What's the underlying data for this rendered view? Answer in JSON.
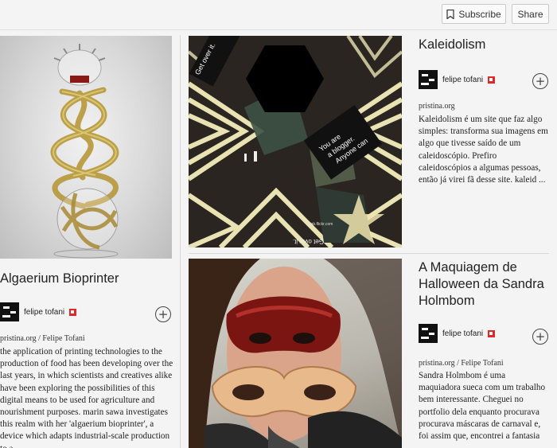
{
  "toolbar": {
    "subscribe_label": "Subscribe",
    "share_label": "Share",
    "subscribe_icon": "bookmark-icon"
  },
  "articles": [
    {
      "title": "Algaerium Bioprinter",
      "author": "felipe tofani",
      "source": "pristina.org / Felipe Tofani",
      "excerpt": "the application of printing technologies to the production of food has been developing over the last years, in which scientists and creatives alike have been exploring the possibilities of this digital means to be used for agriculture and nourishment purposes. marin sawa investigates this realm with her 'algaerium bioprinter', a device which adapts industrial-scale production to a"
    },
    {
      "title": "Kaleidolism",
      "author": "felipe tofani",
      "source": "pristina.org",
      "excerpt": "Kaleidolism é um site que faz algo simples: transforma sua imagens em algo que tivesse saído de um caleidoscópio. Prefiro caleidoscópios a algumas pessoas, então já virei fã desse site. kaleid ..."
    },
    {
      "title": "A Maquiagem de Halloween da Sandra Holmbom",
      "author": "felipe tofani",
      "source": "pristina.org / Felipe Tofani",
      "excerpt": "Sandra Holmbom é uma maquiadora sueca com um trabalho bem interessante. Cheguei no portfolio dela enquanto procurava procurava máscaras de carnaval e, foi assim que, encontrei a fantasia"
    }
  ],
  "images": {
    "kaleido_text_1": "You are a blogger. Anyone can be that. Get over it.",
    "kaleido_text_2": "You are a blogger. Anyone can be that. Get over it.",
    "kaleido_text_3": "Get over it.",
    "kaleido_text_4": "xlab.flickr.com"
  },
  "colors": {
    "flag_red": "#e12828",
    "background": "#f4f4f4"
  }
}
